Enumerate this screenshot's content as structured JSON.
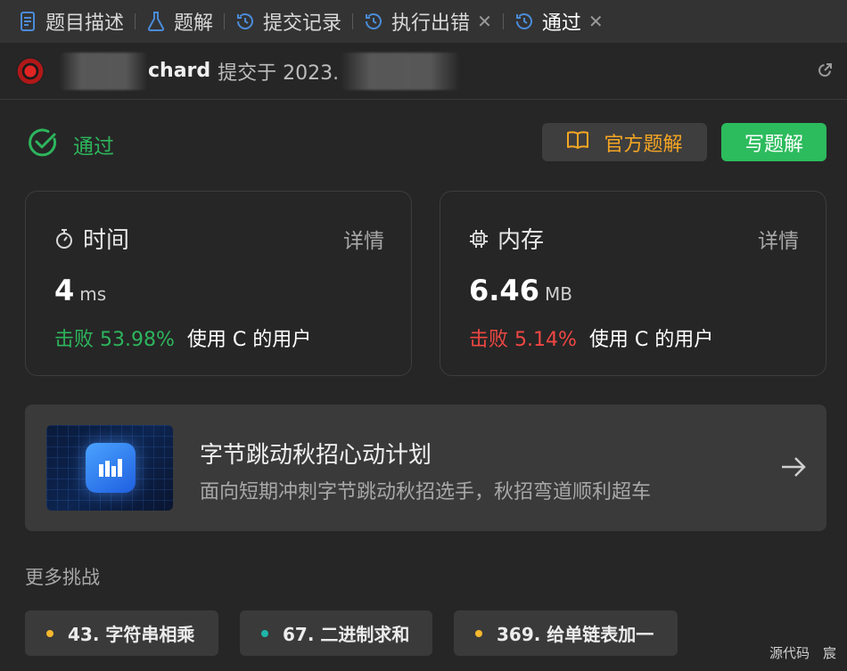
{
  "tabs": [
    {
      "label": "题目描述",
      "icon": "document-icon",
      "closable": false
    },
    {
      "label": "题解",
      "icon": "flask-icon",
      "closable": false
    },
    {
      "label": "提交记录",
      "icon": "history-icon",
      "closable": false
    },
    {
      "label": "执行出错",
      "icon": "history-icon",
      "closable": true
    },
    {
      "label": "通过",
      "icon": "history-icon",
      "closable": true,
      "active": true
    }
  ],
  "submission": {
    "username_visible": "chard",
    "submitted_prefix": "提交于 2023."
  },
  "status": {
    "label": "通过",
    "color": "#2db55d"
  },
  "actions": {
    "official_solution": "官方题解",
    "write_solution": "写题解"
  },
  "runtime": {
    "title": "时间",
    "detail": "详情",
    "value": "4",
    "unit": "ms",
    "beat_prefix": "击败",
    "beat_percent": "53.98%",
    "beat_suffix": "使用 C 的用户",
    "beat_color": "#2db55d"
  },
  "memory": {
    "title": "内存",
    "detail": "详情",
    "value": "6.46",
    "unit": "MB",
    "beat_prefix": "击败",
    "beat_percent": "5.14%",
    "beat_suffix": "使用 C 的用户",
    "beat_color": "#ef4743"
  },
  "banner": {
    "title": "字节跳动秋招心动计划",
    "subtitle": "面向短期冲刺字节跳动秋招选手，秋招弯道顺利超车"
  },
  "more": {
    "title": "更多挑战",
    "challenges": [
      {
        "label": "43. 字符串相乘",
        "dot_color": "#f5b82e"
      },
      {
        "label": "67. 二进制求和",
        "dot_color": "#1fb5a8"
      },
      {
        "label": "369. 给单链表加一",
        "dot_color": "#f5b82e"
      }
    ]
  },
  "watermark": "源代码　宸"
}
